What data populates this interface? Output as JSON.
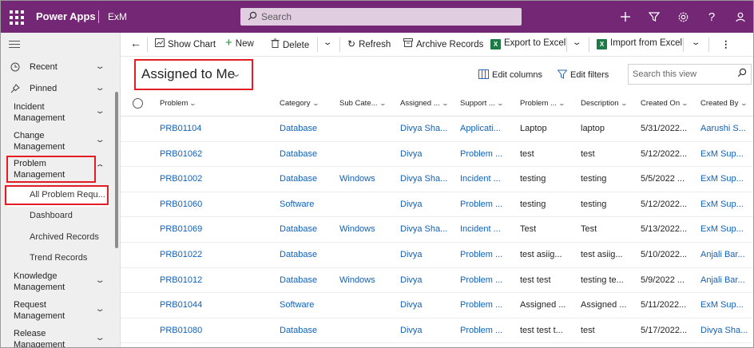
{
  "topbar": {
    "app_name": "Power Apps",
    "env_name": "ExM",
    "search_placeholder": "Search",
    "brand_color": "#742774"
  },
  "sidebar": {
    "recent": "Recent",
    "pinned": "Pinned",
    "groups": [
      {
        "label_line1": "Incident",
        "label_line2": "Management"
      },
      {
        "label_line1": "Change",
        "label_line2": "Management"
      },
      {
        "label_line1": "Problem",
        "label_line2": "Management"
      }
    ],
    "sub_items": [
      "All Problem Requ...",
      "Dashboard",
      "Archived Records",
      "Trend Records"
    ],
    "groups_after": [
      {
        "label_line1": "Knowledge",
        "label_line2": "Management"
      },
      {
        "label_line1": "Request",
        "label_line2": "Management"
      },
      {
        "label_line1": "Release",
        "label_line2": "Management"
      }
    ]
  },
  "commands": {
    "show_chart": "Show Chart",
    "new": "New",
    "delete": "Delete",
    "refresh": "Refresh",
    "archive": "Archive Records",
    "export_excel": "Export to Excel",
    "import_excel": "Import from Excel"
  },
  "view": {
    "title": "Assigned to Me",
    "edit_columns": "Edit columns",
    "edit_filters": "Edit filters",
    "search_placeholder": "Search this view"
  },
  "columns": [
    "Problem",
    "Category",
    "Sub Cate...",
    "Assigned ...",
    "Support ...",
    "Problem ...",
    "Description",
    "Created On",
    "Created By"
  ],
  "rows": [
    [
      "PRB01104",
      "Database",
      "",
      "Divya Sha...",
      "Applicati...",
      "Laptop",
      "laptop",
      "5/31/2022...",
      "Aarushi S..."
    ],
    [
      "PRB01062",
      "Database",
      "",
      "Divya",
      "Problem ...",
      "test",
      "test",
      "5/12/2022...",
      "ExM Sup..."
    ],
    [
      "PRB01002",
      "Database",
      "Windows",
      "Divya Sha...",
      "Incident ...",
      "testing",
      "testing",
      "5/5/2022 ...",
      "ExM Sup..."
    ],
    [
      "PRB01060",
      "Software",
      "",
      "Divya",
      "Problem ...",
      "testing",
      "testing",
      "5/12/2022...",
      "ExM Sup..."
    ],
    [
      "PRB01069",
      "Database",
      "Windows",
      "Divya Sha...",
      "Incident ...",
      "Test",
      "Test",
      "5/13/2022...",
      "ExM Sup..."
    ],
    [
      "PRB01022",
      "Database",
      "",
      "Divya",
      "Problem ...",
      "test asiig...",
      "test asiig...",
      "5/10/2022...",
      "Anjali Bar..."
    ],
    [
      "PRB01012",
      "Database",
      "Windows",
      "Divya",
      "Problem ...",
      "test test",
      "testing te...",
      "5/9/2022 ...",
      "Anjali Bar..."
    ],
    [
      "PRB01044",
      "Software",
      "",
      "Divya",
      "Problem ...",
      "Assigned ...",
      "Assigned ...",
      "5/11/2022...",
      "ExM Sup..."
    ],
    [
      "PRB01080",
      "Database",
      "",
      "Divya",
      "Problem ...",
      "test test t...",
      "test",
      "5/17/2022...",
      "Divya Sha..."
    ]
  ]
}
